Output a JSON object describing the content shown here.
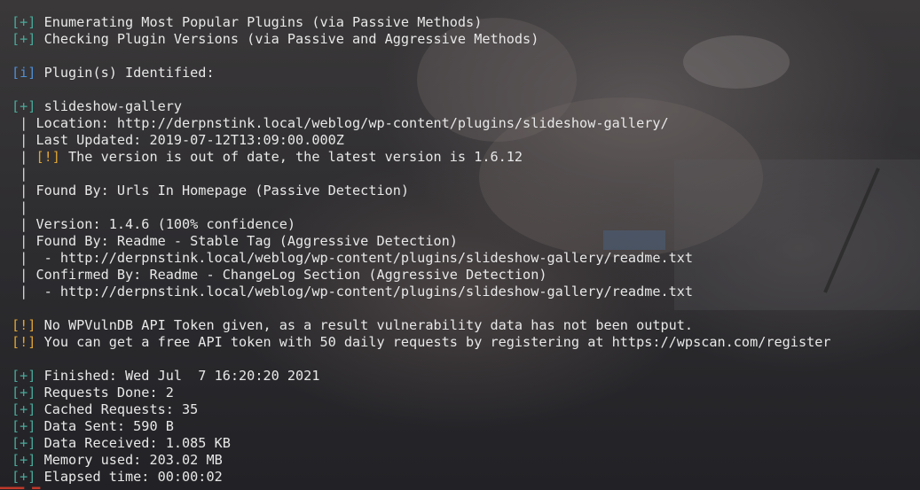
{
  "lines": [
    {
      "tag": "[+]",
      "tag_type": "plus",
      "text": " Enumerating Most Popular Plugins (via Passive Methods)"
    },
    {
      "tag": "[+]",
      "tag_type": "plus",
      "text": " Checking Plugin Versions (via Passive and Aggressive Methods)"
    },
    {
      "blank": true
    },
    {
      "tag": "[i]",
      "tag_type": "info",
      "text": " Plugin(s) Identified:"
    },
    {
      "blank": true
    },
    {
      "tag": "[+]",
      "tag_type": "plus",
      "text": " slideshow-gallery"
    },
    {
      "prefix": " | ",
      "text": "Location: http://derpnstink.local/weblog/wp-content/plugins/slideshow-gallery/"
    },
    {
      "prefix": " | ",
      "text": "Last Updated: 2019-07-12T13:09:00.000Z"
    },
    {
      "prefix": " | ",
      "tag": "[!]",
      "tag_type": "warn",
      "text": " The version is out of date, the latest version is 1.6.12"
    },
    {
      "prefix": " |",
      "text": ""
    },
    {
      "prefix": " | ",
      "text": "Found By: Urls In Homepage (Passive Detection)"
    },
    {
      "prefix": " |",
      "text": ""
    },
    {
      "prefix": " | ",
      "text": "Version: 1.4.6 (100% confidence)"
    },
    {
      "prefix": " | ",
      "text": "Found By: Readme - Stable Tag (Aggressive Detection)"
    },
    {
      "prefix": " |  ",
      "text": "- http://derpnstink.local/weblog/wp-content/plugins/slideshow-gallery/readme.txt"
    },
    {
      "prefix": " | ",
      "text": "Confirmed By: Readme - ChangeLog Section (Aggressive Detection)"
    },
    {
      "prefix": " |  ",
      "text": "- http://derpnstink.local/weblog/wp-content/plugins/slideshow-gallery/readme.txt"
    },
    {
      "blank": true
    },
    {
      "tag": "[!]",
      "tag_type": "warn",
      "text": " No WPVulnDB API Token given, as a result vulnerability data has not been output."
    },
    {
      "tag": "[!]",
      "tag_type": "warn",
      "text": " You can get a free API token with 50 daily requests by registering at https://wpscan.com/register"
    },
    {
      "blank": true
    },
    {
      "tag": "[+]",
      "tag_type": "plus",
      "text": " Finished: Wed Jul  7 16:20:20 2021"
    },
    {
      "tag": "[+]",
      "tag_type": "plus",
      "text": " Requests Done: 2"
    },
    {
      "tag": "[+]",
      "tag_type": "plus",
      "text": " Cached Requests: 35"
    },
    {
      "tag": "[+]",
      "tag_type": "plus",
      "text": " Data Sent: 590 B"
    },
    {
      "tag": "[+]",
      "tag_type": "plus",
      "text": " Data Received: 1.085 KB"
    },
    {
      "tag": "[+]",
      "tag_type": "plus",
      "text": " Memory used: 203.02 MB"
    },
    {
      "tag": "[+]",
      "tag_type": "plus",
      "text": " Elapsed time: 00:00:02"
    }
  ],
  "colors": {
    "plus": "#49a99a",
    "info": "#4f8fd6",
    "warn": "#e0a634",
    "text": "#e8e8e8"
  }
}
